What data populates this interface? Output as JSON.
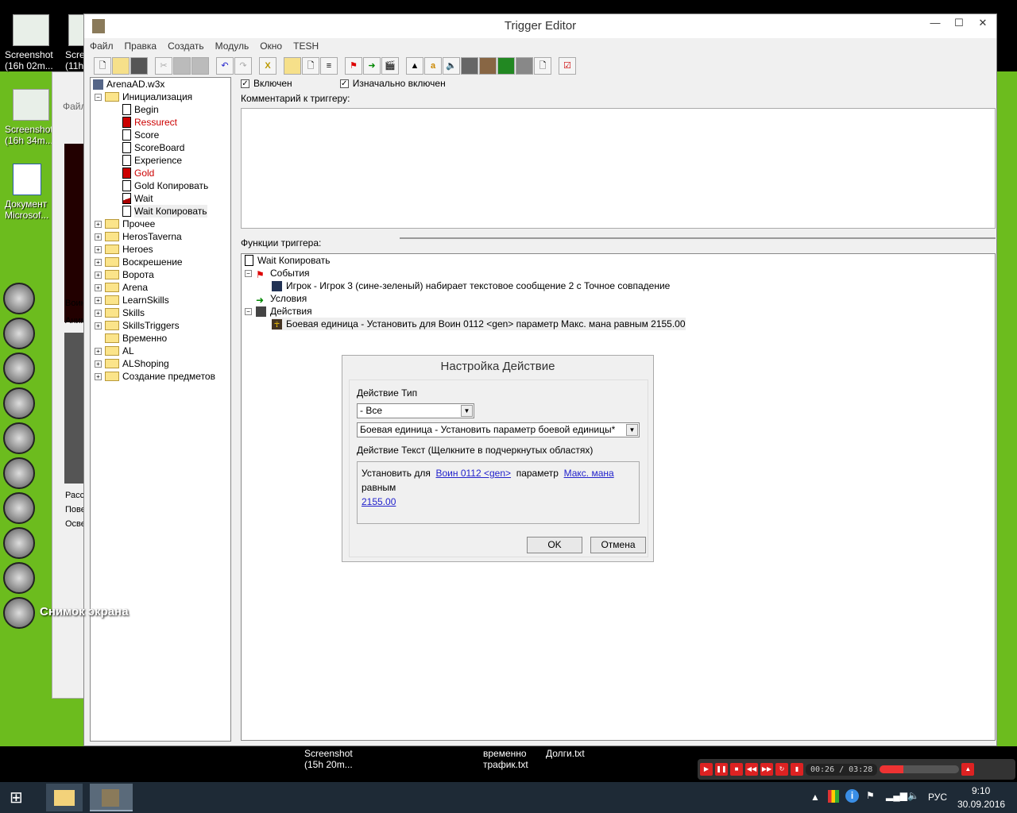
{
  "desktop": {
    "icons": [
      {
        "label": "Screenshot (16h 02m..."
      },
      {
        "label": "Scre (11h"
      },
      {
        "label": "Screenshot (16h 34m..."
      },
      {
        "label": "Документ Microsof..."
      }
    ],
    "dock_label": "Снимок экрана",
    "bottom_files": [
      {
        "label": "Screenshot (15h 20m..."
      },
      {
        "label": "временно трафик.txt"
      },
      {
        "label": "Долги.txt"
      }
    ]
  },
  "behind_window": {
    "menu": "Файл",
    "labels": [
      "Воин",
      "Аним",
      "Расс",
      "Пове",
      "Осве"
    ]
  },
  "window": {
    "title": "Trigger Editor",
    "minimize": "—",
    "maximize": "☐",
    "close": "✕",
    "menu": [
      "Файл",
      "Правка",
      "Создать",
      "Модуль",
      "Окно",
      "TESH"
    ],
    "toolbar": [
      "new",
      "open",
      "save",
      "cut",
      "copy",
      "paste",
      "undo",
      "redo",
      "delete",
      "category",
      "trigger",
      "comment",
      "event",
      "condition",
      "action",
      "terrain",
      "object",
      "sound",
      "unit",
      "item",
      "ability",
      "destructable",
      "import",
      "test"
    ]
  },
  "tree": {
    "root": "ArenaAD.w3x",
    "open_folder": "Инициализация",
    "triggers": [
      {
        "label": "Begin",
        "state": "normal"
      },
      {
        "label": "Ressurect",
        "state": "disabled"
      },
      {
        "label": "Score",
        "state": "normal"
      },
      {
        "label": "ScoreBoard",
        "state": "normal"
      },
      {
        "label": "Experience",
        "state": "normal"
      },
      {
        "label": "Gold",
        "state": "disabled"
      },
      {
        "label": "Gold Копировать",
        "state": "normal"
      },
      {
        "label": "Wait",
        "state": "initially-off"
      },
      {
        "label": "Wait Копировать",
        "state": "selected"
      }
    ],
    "folders": [
      "Прочее",
      "HerosTaverna",
      "Heroes",
      "Воскрешение",
      "Ворота",
      "Arena",
      "LearnSkills",
      "Skills",
      "SkillsTriggers",
      "Временно",
      "AL",
      "ALShoping",
      "Создание предметов"
    ]
  },
  "trigger": {
    "enabled_label": "Включен",
    "enabled": true,
    "initially_on_label": "Изначально включен",
    "initially_on": true,
    "comment_label": "Комментарий к триггеру:",
    "comment": "",
    "functions_label": "Функции триггера:",
    "name": "Wait Копировать",
    "events_label": "События",
    "event": "Игрок - Игрок 3 (сине-зеленый) набирает текстовое сообщение 2 с Точное совпадение",
    "conditions_label": "Условия",
    "actions_label": "Действия",
    "action": "Боевая единица - Установить для Воин 0112 <gen> параметр Макс. мана равным 2155.00"
  },
  "dialog": {
    "title": "Настройка Действие",
    "type_label": "Действие Тип",
    "type_value": "- Все",
    "action_value": "Боевая единица - Установить параметр боевой единицы*",
    "text_label": "Действие Текст (Щелкните в подчеркнутых областях)",
    "text_parts": {
      "p1": "Установить для",
      "l1": "Воин 0112 <gen>",
      "p2": "параметр",
      "l2": "Макс. мана",
      "p3": "равным",
      "l3": "2155.00"
    },
    "ok": "OK",
    "cancel": "Отмена"
  },
  "player": {
    "time": "00:26 / 03:28",
    "volume_percent": 30
  },
  "taskbar": {
    "lang": "РУС",
    "time": "9:10",
    "date": "30.09.2016"
  }
}
